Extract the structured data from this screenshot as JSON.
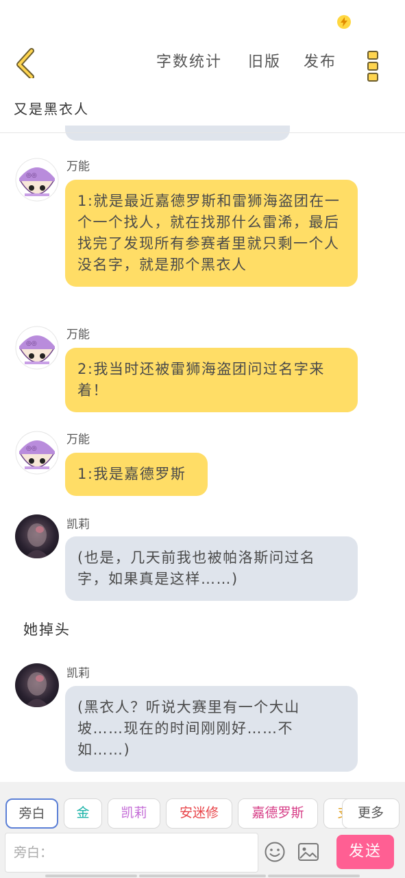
{
  "header": {
    "word_count_label": "字数统计",
    "old_version_label": "旧版",
    "publish_label": "发布"
  },
  "story": {
    "title": "又是黑衣人"
  },
  "messages": [
    {
      "sender": "万能",
      "text": "1:就是最近嘉德罗斯和雷狮海盗团在一个一个找人，就在找那什么雷浠，最后找完了发现所有参赛者里就只剩一个人没名字，就是那个黑衣人"
    },
    {
      "sender": "万能",
      "text": "2:我当时还被雷狮海盗团问过名字来着！"
    },
    {
      "sender": "万能",
      "text": "1:我是嘉德罗斯"
    },
    {
      "sender": "凯莉",
      "text": "(也是，几天前我也被帕洛斯问过名字，如果真是这样……)"
    },
    {
      "sender": "凯莉",
      "text": "(黑衣人？听说大赛里有一个大山坡……现在的时间刚刚好……不如……)"
    }
  ],
  "narration": "她掉头",
  "composer": {
    "tabs": [
      "旁白",
      "金",
      "凯莉",
      "安迷修",
      "嘉德罗斯",
      "支"
    ],
    "tab_colors": [
      "#555555",
      "#1bb3a8",
      "#c36ad6",
      "#e8454a",
      "#d63c86",
      "#e0a020"
    ],
    "more_label": "更多",
    "input_placeholder": "旁白：",
    "send_label": "发送"
  },
  "colors": {
    "accent": "#ff5f93",
    "bubble_yellow": "#ffdd66",
    "bubble_gray": "#dfe4ec",
    "active_tab_border": "#5b7fd6"
  }
}
